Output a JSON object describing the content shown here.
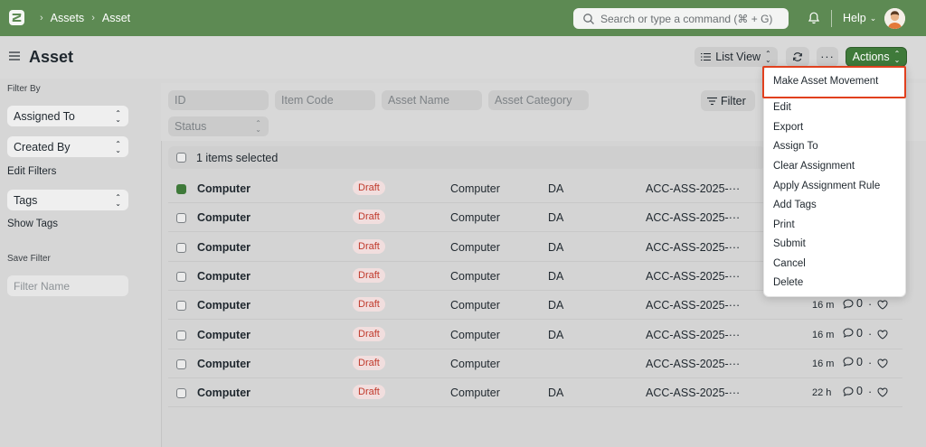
{
  "navbar": {
    "breadcrumbs": [
      "Assets",
      "Asset"
    ],
    "search_placeholder": "Search or type a command (⌘ + G)",
    "help_label": "Help"
  },
  "page": {
    "title": "Asset",
    "list_view_label": "List View",
    "more_label": "···",
    "actions_label": "Actions"
  },
  "sidebar": {
    "filter_by_label": "Filter By",
    "assigned_to": "Assigned To",
    "created_by": "Created By",
    "edit_filters": "Edit Filters",
    "tags": "Tags",
    "show_tags": "Show Tags",
    "save_filter_label": "Save Filter",
    "filter_name_placeholder": "Filter Name"
  },
  "filters": {
    "id_placeholder": "ID",
    "item_code_placeholder": "Item Code",
    "asset_name_placeholder": "Asset Name",
    "asset_category_placeholder": "Asset Category",
    "status_placeholder": "Status",
    "filter_button": "Filter"
  },
  "list": {
    "selected_text": "1 items selected",
    "rows": [
      {
        "name": "Computer",
        "status": "Draft",
        "category": "Computer",
        "location": "DA",
        "id": "ACC-ASS-2025-···",
        "time": "",
        "comments": "",
        "checked": true
      },
      {
        "name": "Computer",
        "status": "Draft",
        "category": "Computer",
        "location": "DA",
        "id": "ACC-ASS-2025-···",
        "time": "",
        "comments": "",
        "checked": false
      },
      {
        "name": "Computer",
        "status": "Draft",
        "category": "Computer",
        "location": "DA",
        "id": "ACC-ASS-2025-···",
        "time": "",
        "comments": "",
        "checked": false
      },
      {
        "name": "Computer",
        "status": "Draft",
        "category": "Computer",
        "location": "DA",
        "id": "ACC-ASS-2025-···",
        "time": "",
        "comments": "",
        "checked": false
      },
      {
        "name": "Computer",
        "status": "Draft",
        "category": "Computer",
        "location": "DA",
        "id": "ACC-ASS-2025-···",
        "time": "16 m",
        "comments": "0",
        "checked": false
      },
      {
        "name": "Computer",
        "status": "Draft",
        "category": "Computer",
        "location": "DA",
        "id": "ACC-ASS-2025-···",
        "time": "16 m",
        "comments": "0",
        "checked": false
      },
      {
        "name": "Computer",
        "status": "Draft",
        "category": "Computer",
        "location": "",
        "id": "ACC-ASS-2025-···",
        "time": "16 m",
        "comments": "0",
        "checked": false
      },
      {
        "name": "Computer",
        "status": "Draft",
        "category": "Computer",
        "location": "DA",
        "id": "ACC-ASS-2025-···",
        "time": "22 h",
        "comments": "0",
        "checked": false
      }
    ]
  },
  "actions_menu": {
    "items": [
      "Make Asset Movement",
      "Edit",
      "Export",
      "Assign To",
      "Clear Assignment",
      "Apply Assignment Rule",
      "Add Tags",
      "Print",
      "Submit",
      "Cancel",
      "Delete"
    ],
    "highlighted_index": 0,
    "highlight_color": "#e1401e"
  },
  "colors": {
    "navbar": "#5d8a53",
    "primary_button": "#3f7a3a",
    "draft_badge_text": "#c0392b",
    "draft_badge_bg": "#f1dede"
  }
}
